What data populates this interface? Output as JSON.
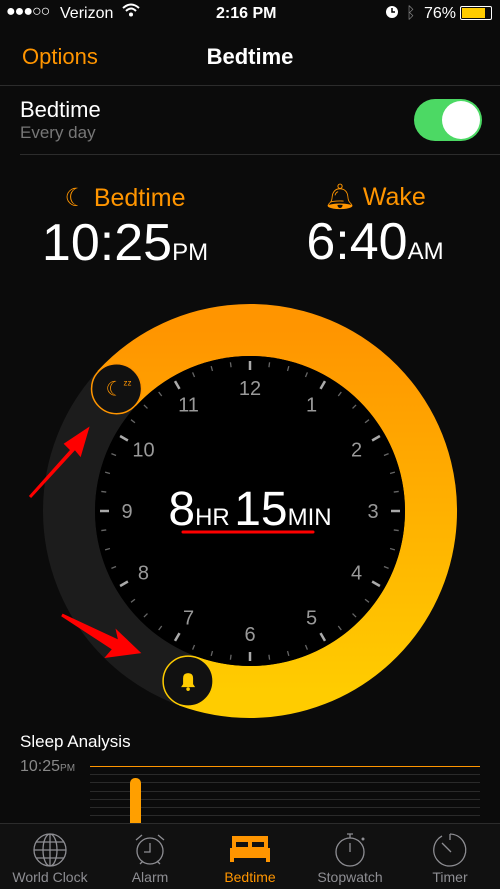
{
  "status": {
    "carrier": "Verizon",
    "signal_bars": 3,
    "time": "2:16 PM",
    "battery": "76%",
    "battery_level": 0.76
  },
  "nav": {
    "left": "Options",
    "title": "Bedtime"
  },
  "setting": {
    "title": "Bedtime",
    "subtitle": "Every day",
    "enabled": true
  },
  "times": {
    "bedtime_label": "Bedtime",
    "bedtime": "10:25",
    "bedtime_ampm": "PM",
    "wake_label": "Wake",
    "wake": "6:40",
    "wake_ampm": "AM"
  },
  "dial": {
    "hours": "8",
    "hr_unit": "HR",
    "minutes": "15",
    "min_unit": "MIN",
    "numbers": [
      "12",
      "1",
      "2",
      "3",
      "4",
      "5",
      "6",
      "7",
      "8",
      "9",
      "10",
      "11"
    ],
    "start_hour": 22.4167,
    "end_hour": 6.6667
  },
  "colors": {
    "accent": "#ff9500",
    "ring_end": "#ffcc00",
    "toggle": "#4cd964",
    "annotation": "#ff0000"
  },
  "sleep": {
    "title": "Sleep Analysis",
    "y_label": "10:25",
    "y_unit": "PM"
  },
  "tabs": [
    {
      "label": "World Clock",
      "icon": "globe-icon"
    },
    {
      "label": "Alarm",
      "icon": "alarm-clock-icon"
    },
    {
      "label": "Bedtime",
      "icon": "bed-icon",
      "active": true
    },
    {
      "label": "Stopwatch",
      "icon": "stopwatch-icon"
    },
    {
      "label": "Timer",
      "icon": "timer-icon"
    }
  ]
}
